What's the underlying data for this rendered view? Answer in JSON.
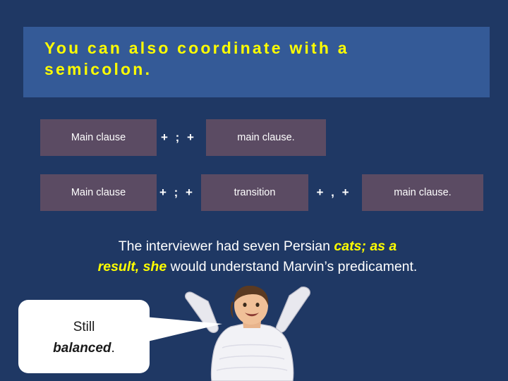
{
  "slide": {
    "background_color": "#1f3864",
    "title": {
      "line1": "You can also coordinate with a",
      "line2": "semicolon",
      "line2_period": ".",
      "banner_color": "#345a97",
      "text_color": "#ffff00"
    },
    "pattern_rows": [
      {
        "cells": [
          {
            "type": "box",
            "label": "Main clause"
          },
          {
            "type": "plus",
            "label": "+ ; +"
          },
          {
            "type": "box",
            "label": "main clause."
          }
        ]
      },
      {
        "cells": [
          {
            "type": "box",
            "label": "Main clause"
          },
          {
            "type": "plus",
            "label": "+ ; +"
          },
          {
            "type": "box",
            "label": "transition"
          },
          {
            "type": "plus",
            "label": "+ , +"
          },
          {
            "type": "box",
            "label": "main clause."
          }
        ]
      }
    ],
    "box_color": "#5b4b63",
    "example": {
      "part1": "The interviewer had seven Persian ",
      "highlight1": "cats; as a",
      "highlight2": "result, she",
      "part2": " would understand Marvin’s predicament."
    },
    "callout": {
      "line1": "Still",
      "line2": "balanced",
      "line2_period": ".",
      "fill_color": "#ffffff"
    }
  }
}
